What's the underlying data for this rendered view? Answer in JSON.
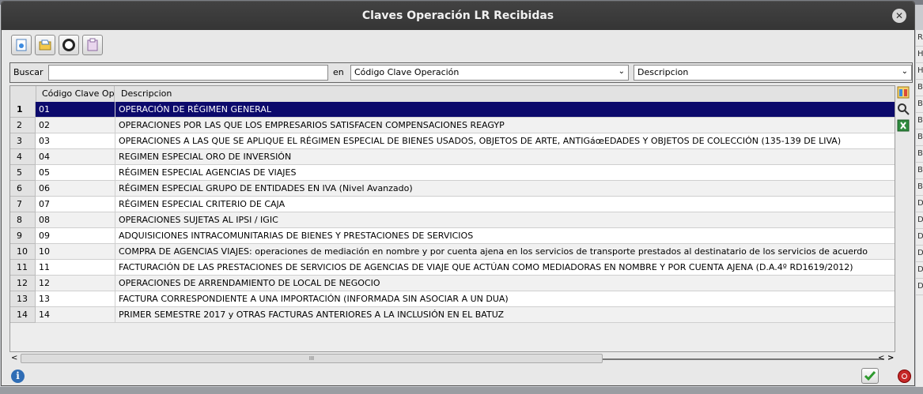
{
  "window": {
    "title": "Claves Operación LR Recibidas"
  },
  "background_fragments": [
    "R",
    "HI",
    "HI",
    "BI",
    "BI",
    "BI",
    "BI",
    "BI",
    "BI",
    "BI",
    "D",
    "D",
    "D",
    "D",
    "D",
    "D"
  ],
  "toolbar": {
    "buttons": [
      {
        "name": "new",
        "icon": "new-record-icon"
      },
      {
        "name": "open",
        "icon": "open-folder-icon"
      },
      {
        "name": "stop",
        "icon": "stop-icon"
      },
      {
        "name": "export",
        "icon": "export-icon"
      }
    ]
  },
  "search": {
    "label": "Buscar",
    "value": "",
    "placeholder": "",
    "in_label": "en",
    "field_select": "Código Clave Operación",
    "order_select": "Descripcion"
  },
  "table": {
    "columns": [
      "Código Clave Operación",
      "Descripcion"
    ],
    "selected_row": 0,
    "rows": [
      {
        "n": "1",
        "code": "01",
        "desc": "OPERACIÓN DE RÉGIMEN GENERAL"
      },
      {
        "n": "2",
        "code": "02",
        "desc": "OPERACIONES POR LAS QUE LOS EMPRESARIOS SATISFACEN COMPENSACIONES REAGYP"
      },
      {
        "n": "3",
        "code": "03",
        "desc": "OPERACIONES A LAS QUE SE APLIQUE EL RÉGIMEN ESPECIAL DE BIENES USADOS, OBJETOS DE ARTE, ANTIGáœEDADES Y OBJETOS DE COLECCIÓN (135-139 DE LIVA)"
      },
      {
        "n": "4",
        "code": "04",
        "desc": "REGIMEN ESPECIAL ORO DE INVERSIÓN"
      },
      {
        "n": "5",
        "code": "05",
        "desc": "RÉGIMEN ESPECIAL AGENCIAS DE VIAJES"
      },
      {
        "n": "6",
        "code": "06",
        "desc": "RÉGIMEN ESPECIAL GRUPO DE ENTIDADES EN IVA (Nivel Avanzado)"
      },
      {
        "n": "7",
        "code": "07",
        "desc": "RÉGIMEN ESPECIAL CRITERIO DE CAJA"
      },
      {
        "n": "8",
        "code": "08",
        "desc": "OPERACIONES SUJETAS AL IPSI  / IGIC"
      },
      {
        "n": "9",
        "code": "09",
        "desc": "ADQUISICIONES INTRACOMUNITARIAS DE BIENES Y PRESTACIONES DE SERVICIOS"
      },
      {
        "n": "10",
        "code": "10",
        "desc": "COMPRA DE AGENCIAS VIAJES: operaciones de mediación en nombre y por cuenta ajena en los servicios de transporte prestados al destinatario de los servicios de acuerdo"
      },
      {
        "n": "11",
        "code": "11",
        "desc": "FACTURACIÓN DE LAS PRESTACIONES DE SERVICIOS DE AGENCIAS DE VIAJE QUE ACTÚAN COMO MEDIADORAS EN NOMBRE Y POR CUENTA AJENA (D.A.4º RD1619/2012)"
      },
      {
        "n": "12",
        "code": "12",
        "desc": "OPERACIONES DE ARRENDAMIENTO DE LOCAL DE NEGOCIO"
      },
      {
        "n": "13",
        "code": "13",
        "desc": "FACTURA CORRESPONDIENTE A UNA IMPORTACIÓN (INFORMADA SIN ASOCIAR A UN DUA)"
      },
      {
        "n": "14",
        "code": "14",
        "desc": "PRIMER SEMESTRE 2017 y OTRAS FACTURAS ANTERIORES A LA INCLUSIÓN EN EL BATUZ"
      }
    ]
  },
  "side_tools": [
    {
      "name": "columns-config-icon"
    },
    {
      "name": "search-icon"
    },
    {
      "name": "excel-export-icon"
    }
  ],
  "scrollbar": {
    "thumb_grip": "III",
    "position_fraction": 0.0
  },
  "footer": {
    "info_icon": "i"
  },
  "colors": {
    "selection": "#0c0a6c",
    "titlebar": "#3b3b3b",
    "ok": "#2e9a2e",
    "cancel": "#c62828"
  }
}
